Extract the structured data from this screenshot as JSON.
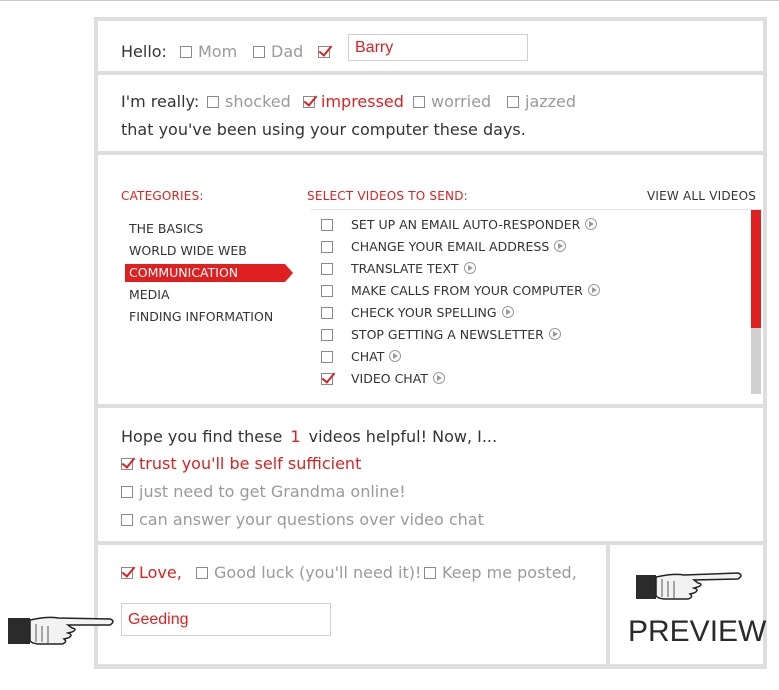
{
  "hello": {
    "label": "Hello:",
    "options": [
      {
        "label": "Mom",
        "checked": false
      },
      {
        "label": "Dad",
        "checked": false
      },
      {
        "label": "",
        "checked": true
      }
    ],
    "name_value": "Barry"
  },
  "feeling": {
    "label": "I'm really:",
    "options": [
      {
        "label": "shocked",
        "checked": false
      },
      {
        "label": "impressed",
        "checked": true
      },
      {
        "label": "worried",
        "checked": false
      },
      {
        "label": "jazzed",
        "checked": false
      }
    ],
    "sentence": "that you've been using your computer these days."
  },
  "videos": {
    "categories_heading": "CATEGORIES:",
    "select_heading": "SELECT VIDEOS TO SEND:",
    "view_all": "VIEW ALL VIDEOS",
    "categories": [
      {
        "label": "THE BASICS",
        "active": false
      },
      {
        "label": "WORLD WIDE WEB",
        "active": false
      },
      {
        "label": "COMMUNICATION",
        "active": true
      },
      {
        "label": "MEDIA",
        "active": false
      },
      {
        "label": "FINDING INFORMATION",
        "active": false
      }
    ],
    "items": [
      {
        "label": "SET UP AN EMAIL AUTO-RESPONDER",
        "checked": false
      },
      {
        "label": "CHANGE YOUR EMAIL ADDRESS",
        "checked": false
      },
      {
        "label": "TRANSLATE TEXT",
        "checked": false
      },
      {
        "label": "MAKE CALLS FROM YOUR COMPUTER",
        "checked": false
      },
      {
        "label": "CHECK YOUR SPELLING",
        "checked": false
      },
      {
        "label": "STOP GETTING A NEWSLETTER",
        "checked": false
      },
      {
        "label": "CHAT",
        "checked": false
      },
      {
        "label": "VIDEO CHAT",
        "checked": true
      }
    ],
    "scroll_fraction_visible": 0.64
  },
  "hope": {
    "prefix": "Hope you find these",
    "count": "1",
    "suffix": "videos helpful! Now, I...",
    "options": [
      {
        "label": "trust you'll be self sufficient",
        "checked": true
      },
      {
        "label": "just need to get Grandma online!",
        "checked": false
      },
      {
        "label": "can answer your questions over video chat",
        "checked": false
      }
    ]
  },
  "signoff": {
    "options": [
      {
        "label": "Love,",
        "checked": true
      },
      {
        "label": "Good luck (you'll need it)!",
        "checked": false
      },
      {
        "label": "Keep me posted,",
        "checked": false
      }
    ],
    "name_value": "Geeding"
  },
  "preview_label": "PREVIEW",
  "colors": {
    "accent": "#e02020",
    "frame": "#dedede",
    "muted": "#9a9a9a"
  },
  "icons": [
    "pointing-hand-icon",
    "play-icon",
    "checkbox-icon"
  ]
}
